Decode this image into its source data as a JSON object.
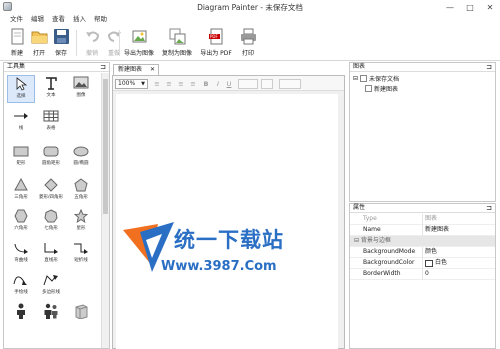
{
  "window": {
    "title": "Diagram Painter - 未保存文档",
    "minimize": "—",
    "maximize": "□",
    "close": "✕"
  },
  "menu": [
    "文件",
    "编辑",
    "查看",
    "插入",
    "帮助"
  ],
  "toolbar": {
    "new": "新建",
    "open": "打开",
    "save": "保存",
    "undo": "撤销",
    "redo": "重做",
    "export_image": "导出为图像",
    "copy_image": "复制为图像",
    "export_pdf": "导出为 PDF",
    "print": "打印"
  },
  "toolbox": {
    "title": "工具集",
    "pin": "⊐",
    "tools": [
      "选择",
      "文本",
      "图像",
      "线",
      "表格",
      "矩形",
      "圆角矩形",
      "圆/椭圆",
      "三角形",
      "菱形/四角形",
      "五角形",
      "六角形",
      "七角形",
      "星形",
      "弯曲线",
      "直线形",
      "短折线",
      "手绘线",
      "多边形线"
    ]
  },
  "document": {
    "tab_label": "新建图表",
    "tab_close": "✕",
    "zoom": "100%",
    "format_icons": [
      "≡",
      "≡",
      "≡",
      "≡",
      "B",
      "I",
      "U"
    ],
    "watermark": {
      "title": "统一下载站",
      "url": "Www.3987.Com"
    }
  },
  "chart_panel": {
    "title": "图表",
    "pin": "⊐",
    "tree": {
      "root": "未保存文档",
      "child": "新建图表"
    }
  },
  "properties": {
    "title": "属性",
    "pin": "⊐",
    "rows": [
      {
        "key": "Type",
        "value": "图表",
        "style": "gray"
      },
      {
        "key": "Name",
        "value": "新建图表",
        "style": "normal"
      },
      {
        "key": "⊟ 背景与边框",
        "value": "",
        "style": "group"
      },
      {
        "key": "BackgroundMode",
        "value": "颜色",
        "style": "normal"
      },
      {
        "key": "BackgroundColor",
        "value": "白色",
        "style": "color",
        "color": "#ffffff"
      },
      {
        "key": "BorderWidth",
        "value": "0",
        "style": "normal"
      }
    ]
  },
  "colors": {
    "accent": "#2aa0e0",
    "logo_blue": "#2a6fc4",
    "logo_orange": "#f07020"
  }
}
